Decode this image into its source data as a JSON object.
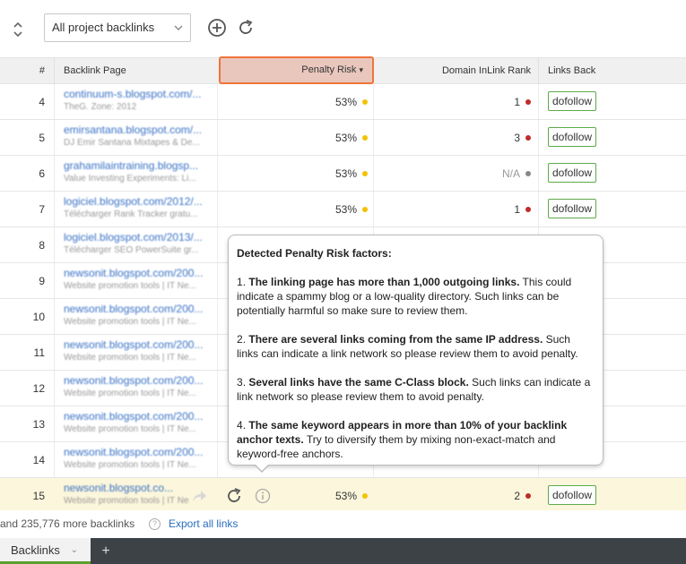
{
  "toolbar": {
    "collapse_icon": "collapse-icon",
    "select_value": "All project backlinks",
    "add_icon": "plus-circle-icon",
    "refresh_icon": "refresh-icon"
  },
  "table": {
    "columns": [
      "#",
      "Backlink Page",
      "Penalty Risk",
      "Domain InLink Rank",
      "Links Back"
    ],
    "sort_indicator": "▾",
    "rows": [
      {
        "num": "4",
        "url": "continuum-s.blogspot.com/...",
        "desc": "TheG. Zone: 2012",
        "penalty": "53%",
        "penalty_color": "yellow",
        "rank": "1",
        "rank_color": "red",
        "links_back": "dofollow"
      },
      {
        "num": "5",
        "url": "emirsantana.blogspot.com/...",
        "desc": "DJ Emir Santana Mixtapes & De...",
        "penalty": "53%",
        "penalty_color": "yellow",
        "rank": "3",
        "rank_color": "red",
        "links_back": "dofollow"
      },
      {
        "num": "6",
        "url": "grahamilaintraining.blogsp...",
        "desc": "Value Investing Experiments: Li...",
        "penalty": "53%",
        "penalty_color": "yellow",
        "rank": "N/A",
        "rank_color": "grey",
        "links_back": "dofollow"
      },
      {
        "num": "7",
        "url": "logiciel.blogspot.com/2012/...",
        "desc": "Télécharger Rank Tracker gratu...",
        "penalty": "53%",
        "penalty_color": "yellow",
        "rank": "1",
        "rank_color": "red",
        "links_back": "dofollow"
      },
      {
        "num": "8",
        "url": "logiciel.blogspot.com/2013/...",
        "desc": "Télécharger SEO PowerSuite gr...",
        "penalty": "",
        "penalty_color": "",
        "rank": "",
        "rank_color": "",
        "links_back": ""
      },
      {
        "num": "9",
        "url": "newsonit.blogspot.com/200...",
        "desc": "Website promotion tools | IT Ne...",
        "penalty": "",
        "penalty_color": "",
        "rank": "",
        "rank_color": "",
        "links_back": ""
      },
      {
        "num": "10",
        "url": "newsonit.blogspot.com/200...",
        "desc": "Website promotion tools | IT Ne...",
        "penalty": "",
        "penalty_color": "",
        "rank": "",
        "rank_color": "",
        "links_back": ""
      },
      {
        "num": "11",
        "url": "newsonit.blogspot.com/200...",
        "desc": "Website promotion tools | IT Ne...",
        "penalty": "",
        "penalty_color": "",
        "rank": "",
        "rank_color": "",
        "links_back": ""
      },
      {
        "num": "12",
        "url": "newsonit.blogspot.com/200...",
        "desc": "Website promotion tools | IT Ne...",
        "penalty": "",
        "penalty_color": "",
        "rank": "",
        "rank_color": "",
        "links_back": ""
      },
      {
        "num": "13",
        "url": "newsonit.blogspot.com/200...",
        "desc": "Website promotion tools | IT Ne...",
        "penalty": "",
        "penalty_color": "",
        "rank": "",
        "rank_color": "",
        "links_back": ""
      },
      {
        "num": "14",
        "url": "newsonit.blogspot.com/200...",
        "desc": "Website promotion tools | IT Ne...",
        "penalty": "",
        "penalty_color": "",
        "rank": "",
        "rank_color": "",
        "links_back": ""
      },
      {
        "num": "15",
        "url": "newsonit.blogspot.co...",
        "desc": "Website promotion tools | IT Ne...",
        "penalty": "53%",
        "penalty_color": "yellow",
        "rank": "2",
        "rank_color": "red",
        "links_back": "dofollow"
      }
    ]
  },
  "tooltip": {
    "title": "Detected Penalty Risk factors:",
    "items": [
      {
        "num": "1",
        "bold": "The linking page has more than 1,000 outgoing links.",
        "text": " This could indicate a spammy blog or a low-quality directory. Such links can be potentially harmful so make sure to review them."
      },
      {
        "num": "2",
        "bold": "There are several links coming from the same IP address.",
        "text": " Such links can indicate a link network so please review them to avoid penalty."
      },
      {
        "num": "3",
        "bold": "Several links have the same C-Class block.",
        "text": " Such links can indicate a link network so please review them to avoid penalty."
      },
      {
        "num": "4",
        "bold": "The same keyword appears in more than 10% of your backlink anchor texts.",
        "text": " Try to diversify them by mixing non-exact-match and keyword-free anchors."
      }
    ]
  },
  "footer": {
    "more_text": "and 235,776 more backlinks",
    "help_glyph": "?",
    "export_label": "Export all links"
  },
  "tabs": {
    "active_label": "Backlinks",
    "chevron": "⌄",
    "add_glyph": "+"
  },
  "colors": {
    "accent_orange": "#f07438",
    "dofollow_green": "#5daa48",
    "risk_yellow": "#f2c200",
    "rank_red": "#c02a2a",
    "link_blue": "#2a6ebd"
  }
}
